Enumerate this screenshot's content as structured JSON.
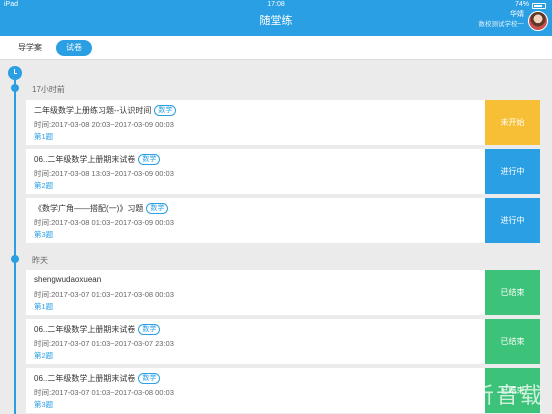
{
  "status_bar": {
    "device": "iPad",
    "time": "17:08",
    "battery": "74%"
  },
  "header": {
    "title": "随堂练",
    "user_name": "华婧",
    "school": "数校测试学校一"
  },
  "tabs": [
    {
      "label": "导学案",
      "active": false
    },
    {
      "label": "试卷",
      "active": true
    }
  ],
  "groups": [
    {
      "label": "17小时前",
      "items": [
        {
          "title": "二年级数学上册练习题--认识时间",
          "subject": "数学",
          "time": "时间:2017-03-08 20:03~2017-03-09 00:03",
          "count": "第1题",
          "status": "未开始",
          "status_type": "not-started"
        },
        {
          "title": "06..二年级数学上册期末试卷",
          "subject": "数学",
          "time": "时间:2017-03-08 13:03~2017-03-09 00:03",
          "count": "第2题",
          "status": "进行中",
          "status_type": "in-progress"
        },
        {
          "title": "《数学广角——搭配(一)》习题",
          "subject": "数学",
          "time": "时间:2017-03-08 01:03~2017-03-09 00:03",
          "count": "第3题",
          "status": "进行中",
          "status_type": "in-progress"
        }
      ]
    },
    {
      "label": "昨天",
      "items": [
        {
          "title": "shengwudaoxuean",
          "subject": "",
          "time": "时间:2017-03-07 01:03~2017-03-08 00:03",
          "count": "第1题",
          "status": "已结束",
          "status_type": "ended"
        },
        {
          "title": "06..二年级数学上册期末试卷",
          "subject": "数学",
          "time": "时间:2017-03-07 01:03~2017-03-07 23:03",
          "count": "第2题",
          "status": "已结束",
          "status_type": "ended"
        },
        {
          "title": "06..二年级数学上册期末试卷",
          "subject": "数学",
          "time": "时间:2017-03-07 01:03~2017-03-08 00:03",
          "count": "第3题",
          "status": "已结束",
          "status_type": "ended"
        }
      ]
    }
  ],
  "watermark": {
    "text": "一听音载"
  },
  "colors": {
    "accent": "#2a9fe3",
    "not_started": "#f6bf35",
    "in_progress": "#2a9fe3",
    "ended": "#3cc279"
  }
}
